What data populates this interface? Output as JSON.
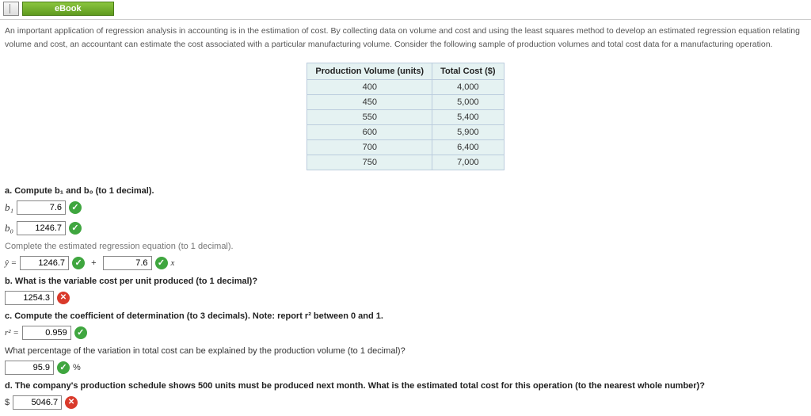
{
  "toolbar": {
    "ebook_label": "eBook"
  },
  "intro": "An important application of regression analysis in accounting is in the estimation of cost. By collecting data on volume and cost and using the least squares method to develop an estimated regression equation relating volume and cost, an accountant can estimate the cost associated with a particular manufacturing volume. Consider the following sample of production volumes and total cost data for a manufacturing operation.",
  "table": {
    "header_vol": "Production Volume (units)",
    "header_cost": "Total Cost ($)",
    "rows": [
      {
        "vol": "400",
        "cost": "4,000"
      },
      {
        "vol": "450",
        "cost": "5,000"
      },
      {
        "vol": "550",
        "cost": "5,400"
      },
      {
        "vol": "600",
        "cost": "5,900"
      },
      {
        "vol": "700",
        "cost": "6,400"
      },
      {
        "vol": "750",
        "cost": "7,000"
      }
    ]
  },
  "qa": {
    "a_prompt": "a. Compute b₁ and b₀ (to 1 decimal).",
    "b1_label": "b₁",
    "b1_value": "7.6",
    "b0_label": "b₀",
    "b0_value": "1246.7",
    "eq_prompt": "Complete the estimated regression equation (to 1 decimal).",
    "eq_yhat": "ŷ =",
    "eq_b0": "1246.7",
    "eq_plus": "+",
    "eq_b1": "7.6",
    "eq_x": "x",
    "b_prompt": "b. What is the variable cost per unit produced (to 1 decimal)?",
    "b_value": "1254.3",
    "c_prompt": "c. Compute the coefficient of determination (to 3 decimals). Note: report r² between 0 and 1.",
    "c_r2_label": "r² =",
    "c_value": "0.959",
    "c2_prompt": "What percentage of the variation in total cost can be explained by the production volume (to 1 decimal)?",
    "c2_value": "95.9",
    "c2_unit": "%",
    "d_prompt": "d. The company's production schedule shows 500 units must be produced next month. What is the estimated total cost for this operation (to the nearest whole number)?",
    "d_prefix": "$",
    "d_value": "5046.7"
  },
  "chart_data": {
    "type": "table",
    "title": "Production Volume vs Total Cost",
    "columns": [
      "Production Volume (units)",
      "Total Cost ($)"
    ],
    "rows": [
      [
        400,
        4000
      ],
      [
        450,
        5000
      ],
      [
        550,
        5400
      ],
      [
        600,
        5900
      ],
      [
        700,
        6400
      ],
      [
        750,
        7000
      ]
    ]
  }
}
